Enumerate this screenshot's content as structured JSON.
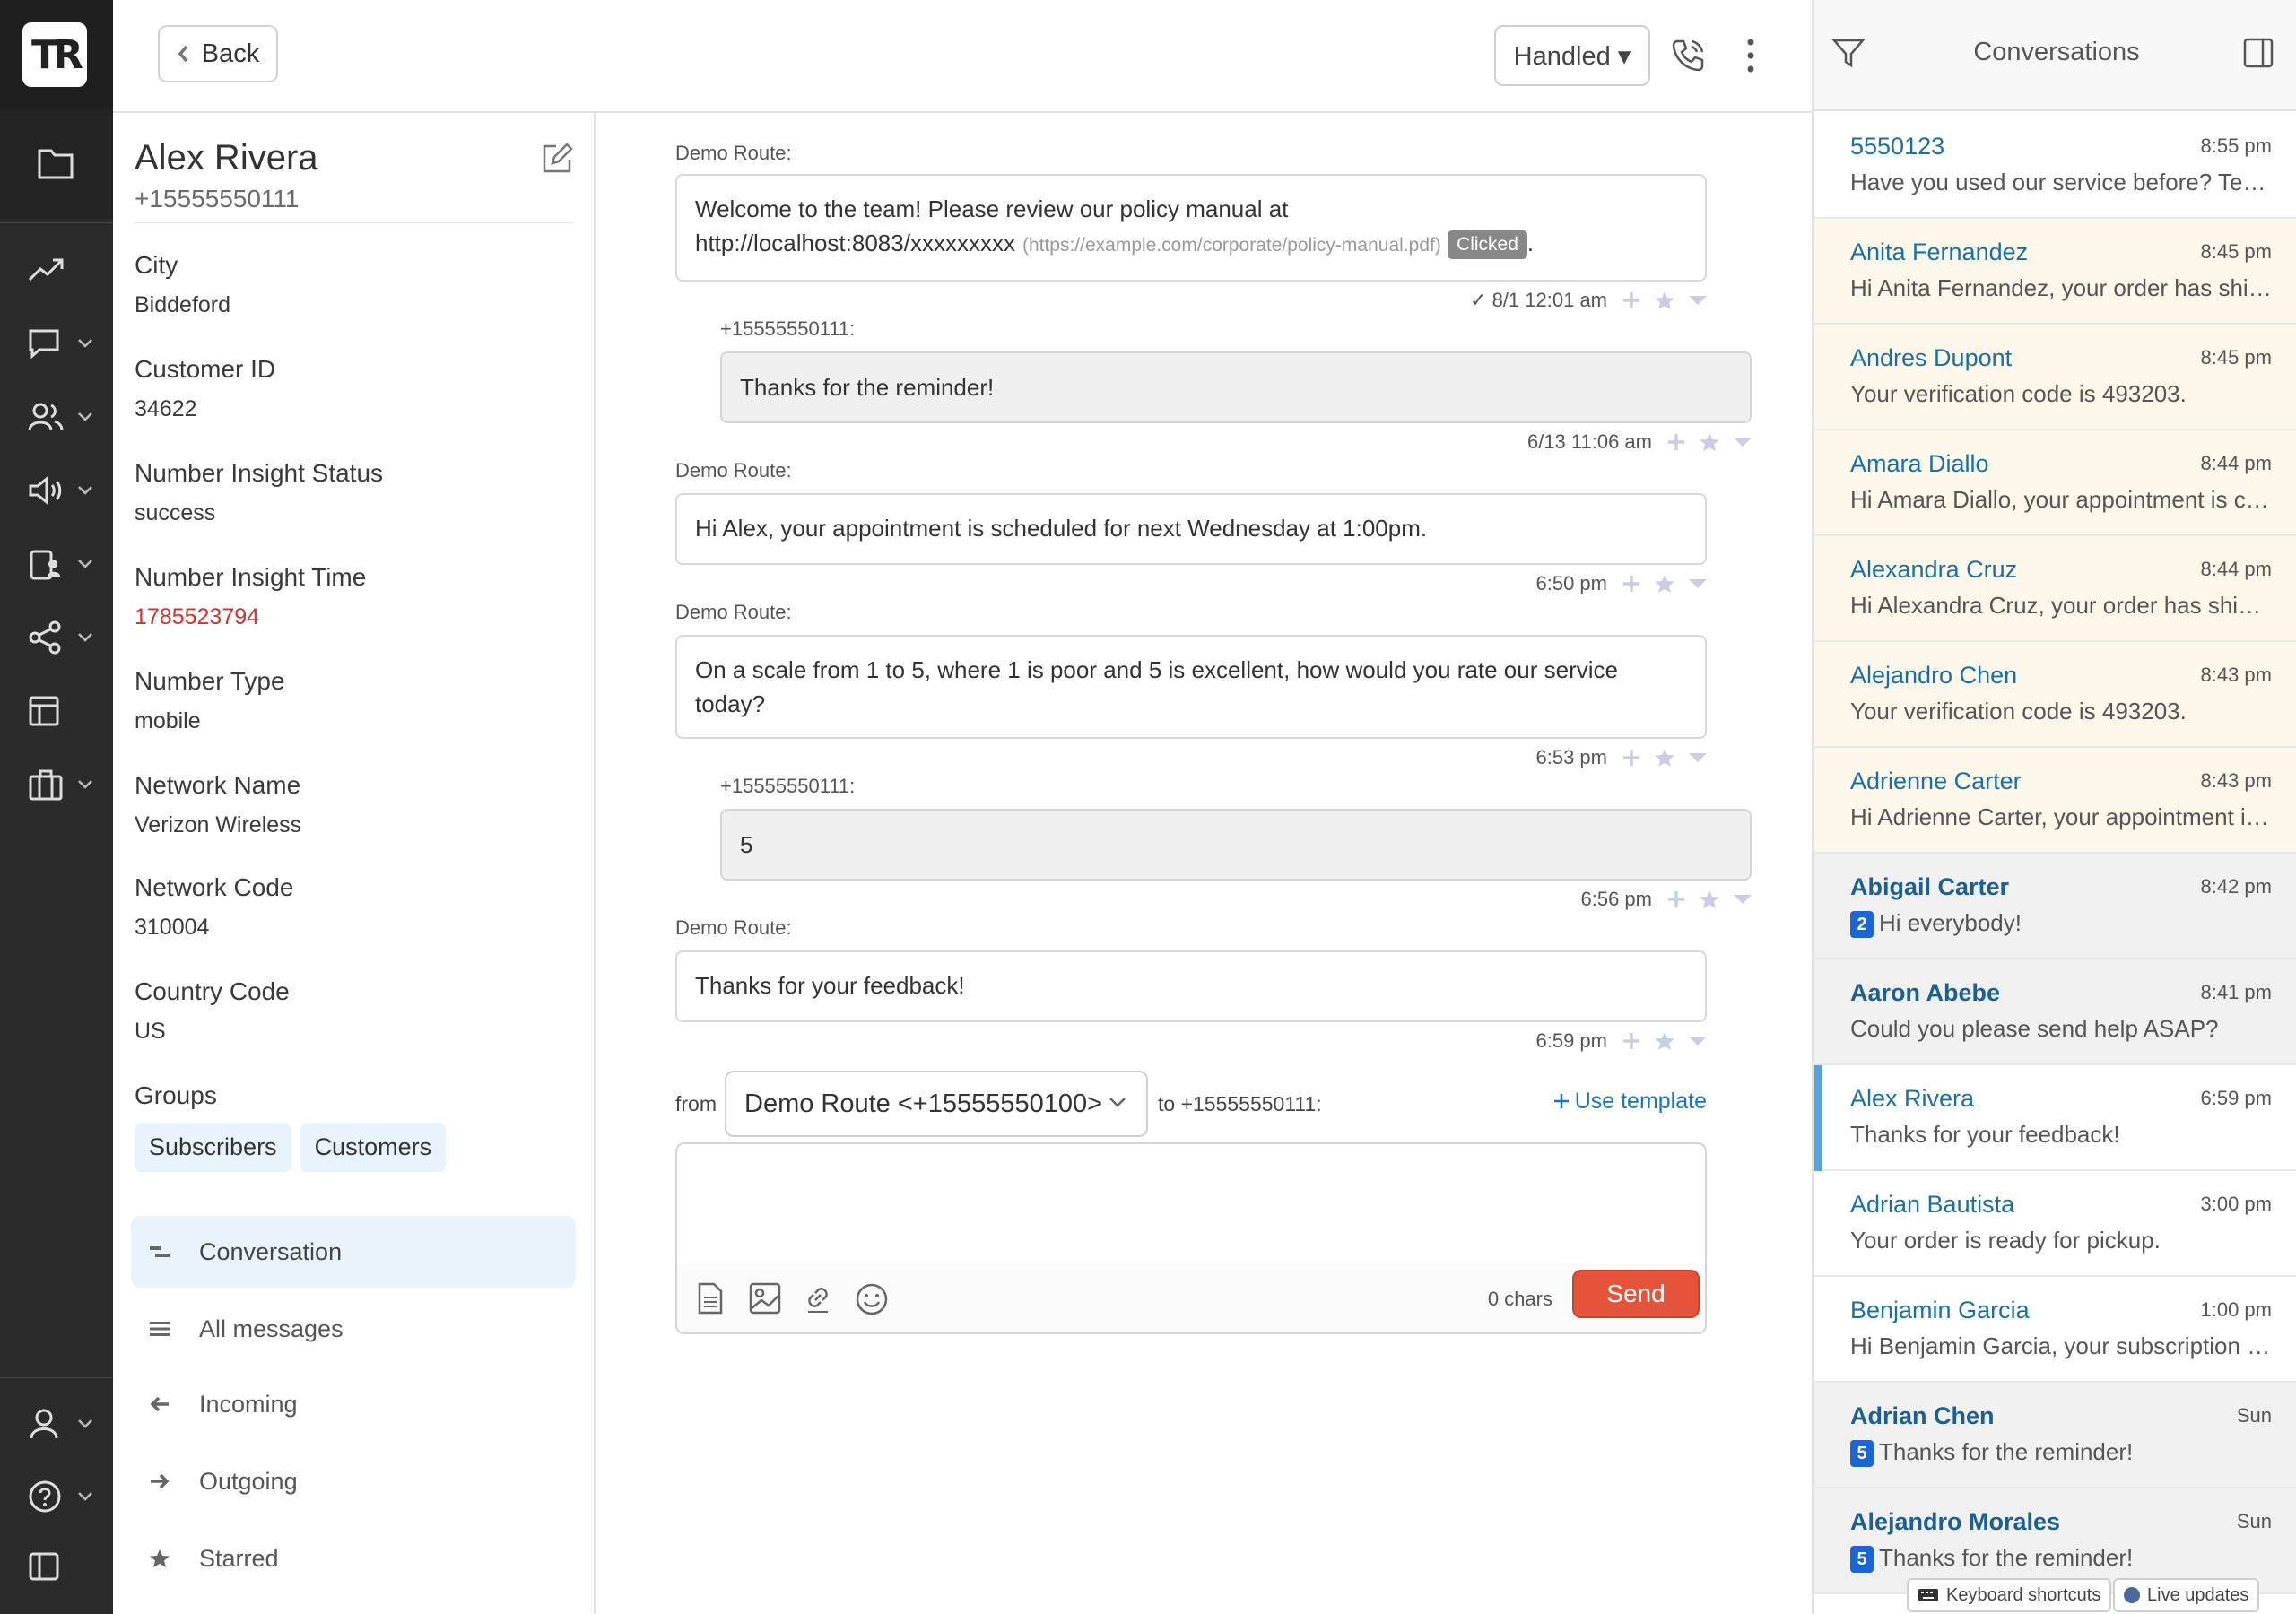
{
  "header": {
    "back_label": "Back",
    "status_label": "Handled ▾"
  },
  "contact": {
    "name": "Alex Rivera",
    "phone": "+15555550111",
    "fields": [
      {
        "label": "City",
        "value": "Biddeford"
      },
      {
        "label": "Customer ID",
        "value": "34622"
      },
      {
        "label": "Number Insight Status",
        "value": "success"
      },
      {
        "label": "Number Insight Time",
        "value": "1785523794"
      },
      {
        "label": "Number Type",
        "value": "mobile"
      },
      {
        "label": "Network Name",
        "value": "Verizon Wireless"
      },
      {
        "label": "Network Code",
        "value": "310004"
      },
      {
        "label": "Country Code",
        "value": "US"
      }
    ],
    "groups_label": "Groups",
    "groups": [
      "Subscribers",
      "Customers"
    ],
    "menu": [
      "Conversation",
      "All messages",
      "Incoming",
      "Outgoing",
      "Starred"
    ]
  },
  "messages": [
    {
      "dir": "out",
      "sender": "Demo Route:",
      "text_line1": "Welcome to the team! Please review our policy manual at",
      "text_line2": "http://localhost:8083/xxxxxxxxx",
      "url_note": "(https://example.com/corporate/policy-manual.pdf)",
      "clicked": "Clicked",
      "trail": ".",
      "meta": "✓ 8/1 12:01 am"
    },
    {
      "dir": "in",
      "sender": "+15555550111:",
      "text": "Thanks for the reminder!",
      "meta": "6/13 11:06 am"
    },
    {
      "dir": "out",
      "sender": "Demo Route:",
      "text": "Hi Alex, your appointment is scheduled for next Wednesday at 1:00pm.",
      "meta": "6:50 pm"
    },
    {
      "dir": "out",
      "sender": "Demo Route:",
      "text": "On a scale from 1 to 5, where 1 is poor and 5 is excellent, how would you rate our service today?",
      "meta": "6:53 pm"
    },
    {
      "dir": "in",
      "sender": "+15555550111:",
      "text": "5",
      "meta": "6:56 pm"
    },
    {
      "dir": "out",
      "sender": "Demo Route:",
      "text": "Thanks for your feedback!",
      "meta": "6:59 pm"
    }
  ],
  "composer": {
    "from_label": "from",
    "route_value": "Demo Route <+15555550100>",
    "to_label": "to +15555550111:",
    "use_template": "Use template",
    "placeholder": "",
    "chars": "0 chars",
    "send_label": "Send"
  },
  "conversations": {
    "title": "Conversations",
    "items": [
      {
        "name": "5550123",
        "time": "8:55 pm",
        "preview": "Have you used our service before? Text YES or NO",
        "badge": "",
        "style": "white",
        "bold": false
      },
      {
        "name": "Anita Fernandez",
        "time": "8:45 pm",
        "preview": "Hi Anita Fernandez, your order has shipped!",
        "badge": "",
        "style": "yellow",
        "bold": false
      },
      {
        "name": "Andres Dupont",
        "time": "8:45 pm",
        "preview": "Your verification code is 493203.",
        "badge": "",
        "style": "yellow",
        "bold": false
      },
      {
        "name": "Amara Diallo",
        "time": "8:44 pm",
        "preview": "Hi Amara Diallo, your appointment is confirmed.",
        "badge": "",
        "style": "yellow",
        "bold": false
      },
      {
        "name": "Alexandra Cruz",
        "time": "8:44 pm",
        "preview": "Hi Alexandra Cruz, your order has shipped!",
        "badge": "",
        "style": "yellow",
        "bold": false
      },
      {
        "name": "Alejandro Chen",
        "time": "8:43 pm",
        "preview": "Your verification code is 493203.",
        "badge": "",
        "style": "yellow",
        "bold": false
      },
      {
        "name": "Adrienne Carter",
        "time": "8:43 pm",
        "preview": "Hi Adrienne Carter, your appointment is confirmed.",
        "badge": "",
        "style": "yellow",
        "bold": false
      },
      {
        "name": "Abigail Carter",
        "time": "8:42 pm",
        "preview": "Hi everybody!",
        "badge": "2",
        "style": "grey",
        "bold": true
      },
      {
        "name": "Aaron Abebe",
        "time": "8:41 pm",
        "preview": "Could you please send help ASAP?",
        "badge": "",
        "style": "grey",
        "bold": true
      },
      {
        "name": "Alex Rivera",
        "time": "6:59 pm",
        "preview": "Thanks for your feedback!",
        "badge": "",
        "style": "sel",
        "bold": false
      },
      {
        "name": "Adrian Bautista",
        "time": "3:00 pm",
        "preview": "Your order is ready for pickup.",
        "badge": "",
        "style": "white",
        "bold": false
      },
      {
        "name": "Benjamin Garcia",
        "time": "1:00 pm",
        "preview": "Hi Benjamin Garcia, your subscription renews soon.",
        "badge": "",
        "style": "white",
        "bold": false
      },
      {
        "name": "Adrian Chen",
        "time": "Sun",
        "preview": "Thanks for the reminder!",
        "badge": "5",
        "style": "grey",
        "bold": true
      },
      {
        "name": "Alejandro Morales",
        "time": "Sun",
        "preview": "Thanks for the reminder!",
        "badge": "5",
        "style": "grey",
        "bold": true
      }
    ]
  },
  "footer": {
    "shortcuts": "Keyboard shortcuts",
    "live": "Live updates"
  }
}
